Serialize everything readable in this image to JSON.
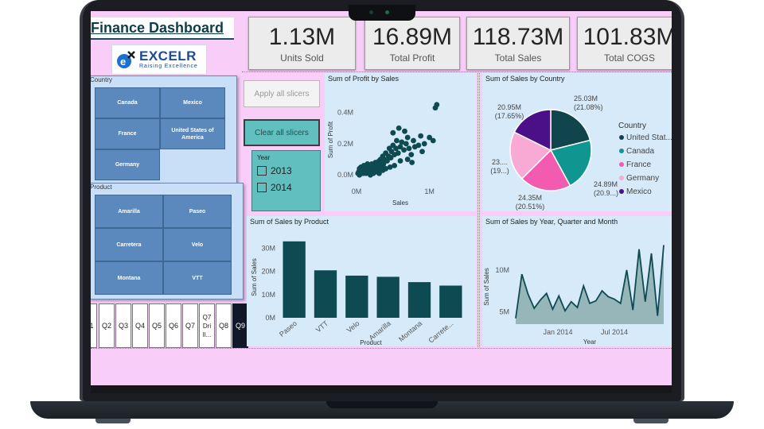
{
  "dashboard": {
    "title": "Finance Dashboard",
    "logo": {
      "brand": "EXCELR",
      "tagline": "Raising Excellence"
    }
  },
  "kpis": [
    {
      "value": "1.13M",
      "label": "Units Sold"
    },
    {
      "value": "16.89M",
      "label": "Total Profit"
    },
    {
      "value": "118.73M",
      "label": "Total Sales"
    },
    {
      "value": "101.83M",
      "label": "Total COGS"
    }
  ],
  "slicers": {
    "country": {
      "header": "Country",
      "items": [
        "Canada",
        "Mexico",
        "France",
        "United States of America",
        "Germany"
      ]
    },
    "product": {
      "header": "Product",
      "items": [
        "Amarilla",
        "Paseo",
        "Carretera",
        "Velo",
        "Montana",
        "VTT"
      ]
    },
    "year": {
      "header": "Year",
      "options": [
        "2013",
        "2014"
      ]
    },
    "quarters": [
      "1",
      "Q2",
      "Q3",
      "Q4",
      "Q5",
      "Q6",
      "Q7",
      "Q7 Dri Il...",
      "Q8",
      "Q9"
    ],
    "selected_quarter": "Q9"
  },
  "buttons": {
    "apply": "Apply all slicers",
    "clear": "Clear all slicers"
  },
  "colors": {
    "background": "#f8cdf8",
    "panel": "#d6eaf9",
    "teal_dark": "#0e4a52",
    "tile_blue": "#5b89bd",
    "year_box": "#61bfbf",
    "pie_us": "#11454d",
    "pie_canada": "#0f9690",
    "pie_france": "#f25bb0",
    "pie_germany": "#f8aad4",
    "pie_mexico": "#4b0f87"
  },
  "chart_data": [
    {
      "type": "scatter",
      "title": "Sum of Profit by Sales",
      "xlabel": "Sales",
      "ylabel": "Sum of Profit",
      "x_ticks": [
        "0M",
        "1M"
      ],
      "y_ticks": [
        "0.0M",
        "0.2M",
        "0.4M"
      ],
      "xlim": [
        0,
        1.2
      ],
      "ylim": [
        -0.05,
        0.5
      ],
      "points": [
        [
          0.02,
          0.01
        ],
        [
          0.03,
          0.02
        ],
        [
          0.04,
          0.0
        ],
        [
          0.05,
          0.03
        ],
        [
          0.06,
          0.01
        ],
        [
          0.07,
          0.02
        ],
        [
          0.08,
          0.04
        ],
        [
          0.09,
          0.01
        ],
        [
          0.1,
          0.03
        ],
        [
          0.11,
          0.02
        ],
        [
          0.12,
          0.05
        ],
        [
          0.13,
          0.01
        ],
        [
          0.14,
          0.04
        ],
        [
          0.15,
          0.02
        ],
        [
          0.16,
          0.06
        ],
        [
          0.17,
          0.03
        ],
        [
          0.18,
          0.01
        ],
        [
          0.19,
          0.05
        ],
        [
          0.2,
          0.02
        ],
        [
          0.21,
          0.07
        ],
        [
          0.22,
          0.04
        ],
        [
          0.23,
          0.03
        ],
        [
          0.24,
          0.06
        ],
        [
          0.25,
          0.02
        ],
        [
          0.26,
          0.08
        ],
        [
          0.27,
          0.05
        ],
        [
          0.28,
          0.03
        ],
        [
          0.29,
          0.07
        ],
        [
          0.3,
          0.04
        ],
        [
          0.31,
          0.09
        ],
        [
          0.32,
          0.06
        ],
        [
          0.33,
          0.1
        ],
        [
          0.34,
          0.05
        ],
        [
          0.35,
          0.08
        ],
        [
          0.36,
          0.12
        ],
        [
          0.37,
          0.07
        ],
        [
          0.38,
          0.1
        ],
        [
          0.4,
          0.14
        ],
        [
          0.42,
          0.09
        ],
        [
          0.44,
          0.12
        ],
        [
          0.45,
          0.17
        ],
        [
          0.47,
          0.11
        ],
        [
          0.48,
          0.15
        ],
        [
          0.5,
          0.19
        ],
        [
          0.52,
          0.13
        ],
        [
          0.54,
          0.17
        ],
        [
          0.55,
          0.22
        ],
        [
          0.57,
          0.14
        ],
        [
          0.6,
          0.18
        ],
        [
          0.62,
          0.21
        ],
        [
          0.65,
          0.16
        ],
        [
          0.68,
          0.2
        ],
        [
          0.7,
          0.24
        ],
        [
          0.72,
          0.17
        ],
        [
          0.75,
          0.13
        ],
        [
          0.78,
          0.22
        ],
        [
          0.8,
          0.18
        ],
        [
          0.85,
          0.19
        ],
        [
          0.88,
          0.25
        ],
        [
          0.9,
          0.15
        ],
        [
          0.93,
          0.2
        ],
        [
          1.0,
          0.24
        ],
        [
          1.05,
          0.22
        ],
        [
          1.08,
          0.43
        ],
        [
          1.1,
          0.45
        ],
        [
          0.58,
          0.3
        ],
        [
          0.66,
          0.28
        ],
        [
          0.5,
          0.27
        ],
        [
          0.04,
          0.04
        ],
        [
          0.06,
          0.05
        ],
        [
          0.1,
          0.06
        ],
        [
          0.15,
          0.07
        ],
        [
          0.19,
          0.0
        ],
        [
          0.23,
          0.01
        ],
        [
          0.27,
          0.02
        ],
        [
          0.31,
          0.01
        ],
        [
          0.36,
          0.03
        ],
        [
          0.4,
          0.04
        ],
        [
          0.46,
          0.05
        ],
        [
          0.52,
          0.06
        ],
        [
          0.6,
          0.09
        ],
        [
          0.7,
          0.1
        ],
        [
          0.76,
          0.08
        ]
      ]
    },
    {
      "type": "pie",
      "title": "Sum of Sales by Country",
      "legend_title": "Country",
      "legend_position": "right",
      "slices": [
        {
          "name": "United States of America",
          "legend": "United Stat...",
          "value": 25.03,
          "label": "25.03M",
          "pct_label": "(21.08%)"
        },
        {
          "name": "Canada",
          "legend": "Canada",
          "value": 24.89,
          "label": "24.89M",
          "pct_label": "(20.9...)"
        },
        {
          "name": "France",
          "legend": "France",
          "value": 24.35,
          "label": "24.35M",
          "pct_label": "(20.51%)"
        },
        {
          "name": "Germany",
          "legend": "Germany",
          "value": 23.5,
          "label": "23....",
          "pct_label": "(19...)"
        },
        {
          "name": "Mexico",
          "legend": "Mexico",
          "value": 20.95,
          "label": "20.95M",
          "pct_label": "(17.65%)"
        }
      ]
    },
    {
      "type": "bar",
      "title": "Sum of Sales by Product",
      "xlabel": "Product",
      "ylabel": "Sum of Sales",
      "categories": [
        "Paseo",
        "VTT",
        "Velo",
        "Amarilla",
        "Montana",
        "Carrete..."
      ],
      "values": [
        33.0,
        20.5,
        18.2,
        17.7,
        15.4,
        13.9
      ],
      "ylim": [
        0,
        35
      ],
      "y_ticks": [
        "0M",
        "10M",
        "20M",
        "30M"
      ]
    },
    {
      "type": "area",
      "title": "Sum of Sales by Year, Quarter and Month",
      "xlabel": "Year",
      "ylabel": "Sum of Sales",
      "x_ticks": [
        "Jan 2014",
        "Jul 2014"
      ],
      "y_ticks": [
        "5M",
        "10M"
      ],
      "ylim": [
        3.5,
        14
      ],
      "values": [
        4.2,
        9.5,
        7.1,
        5.4,
        6.4,
        7.2,
        5.3,
        6.9,
        5.1,
        6.2,
        5.5,
        8.1,
        6.0,
        6.3,
        7.5,
        6.8,
        6.5,
        6.0,
        10.0,
        5.2,
        12.5,
        6.2,
        12.0,
        4.5,
        13.0
      ]
    }
  ]
}
